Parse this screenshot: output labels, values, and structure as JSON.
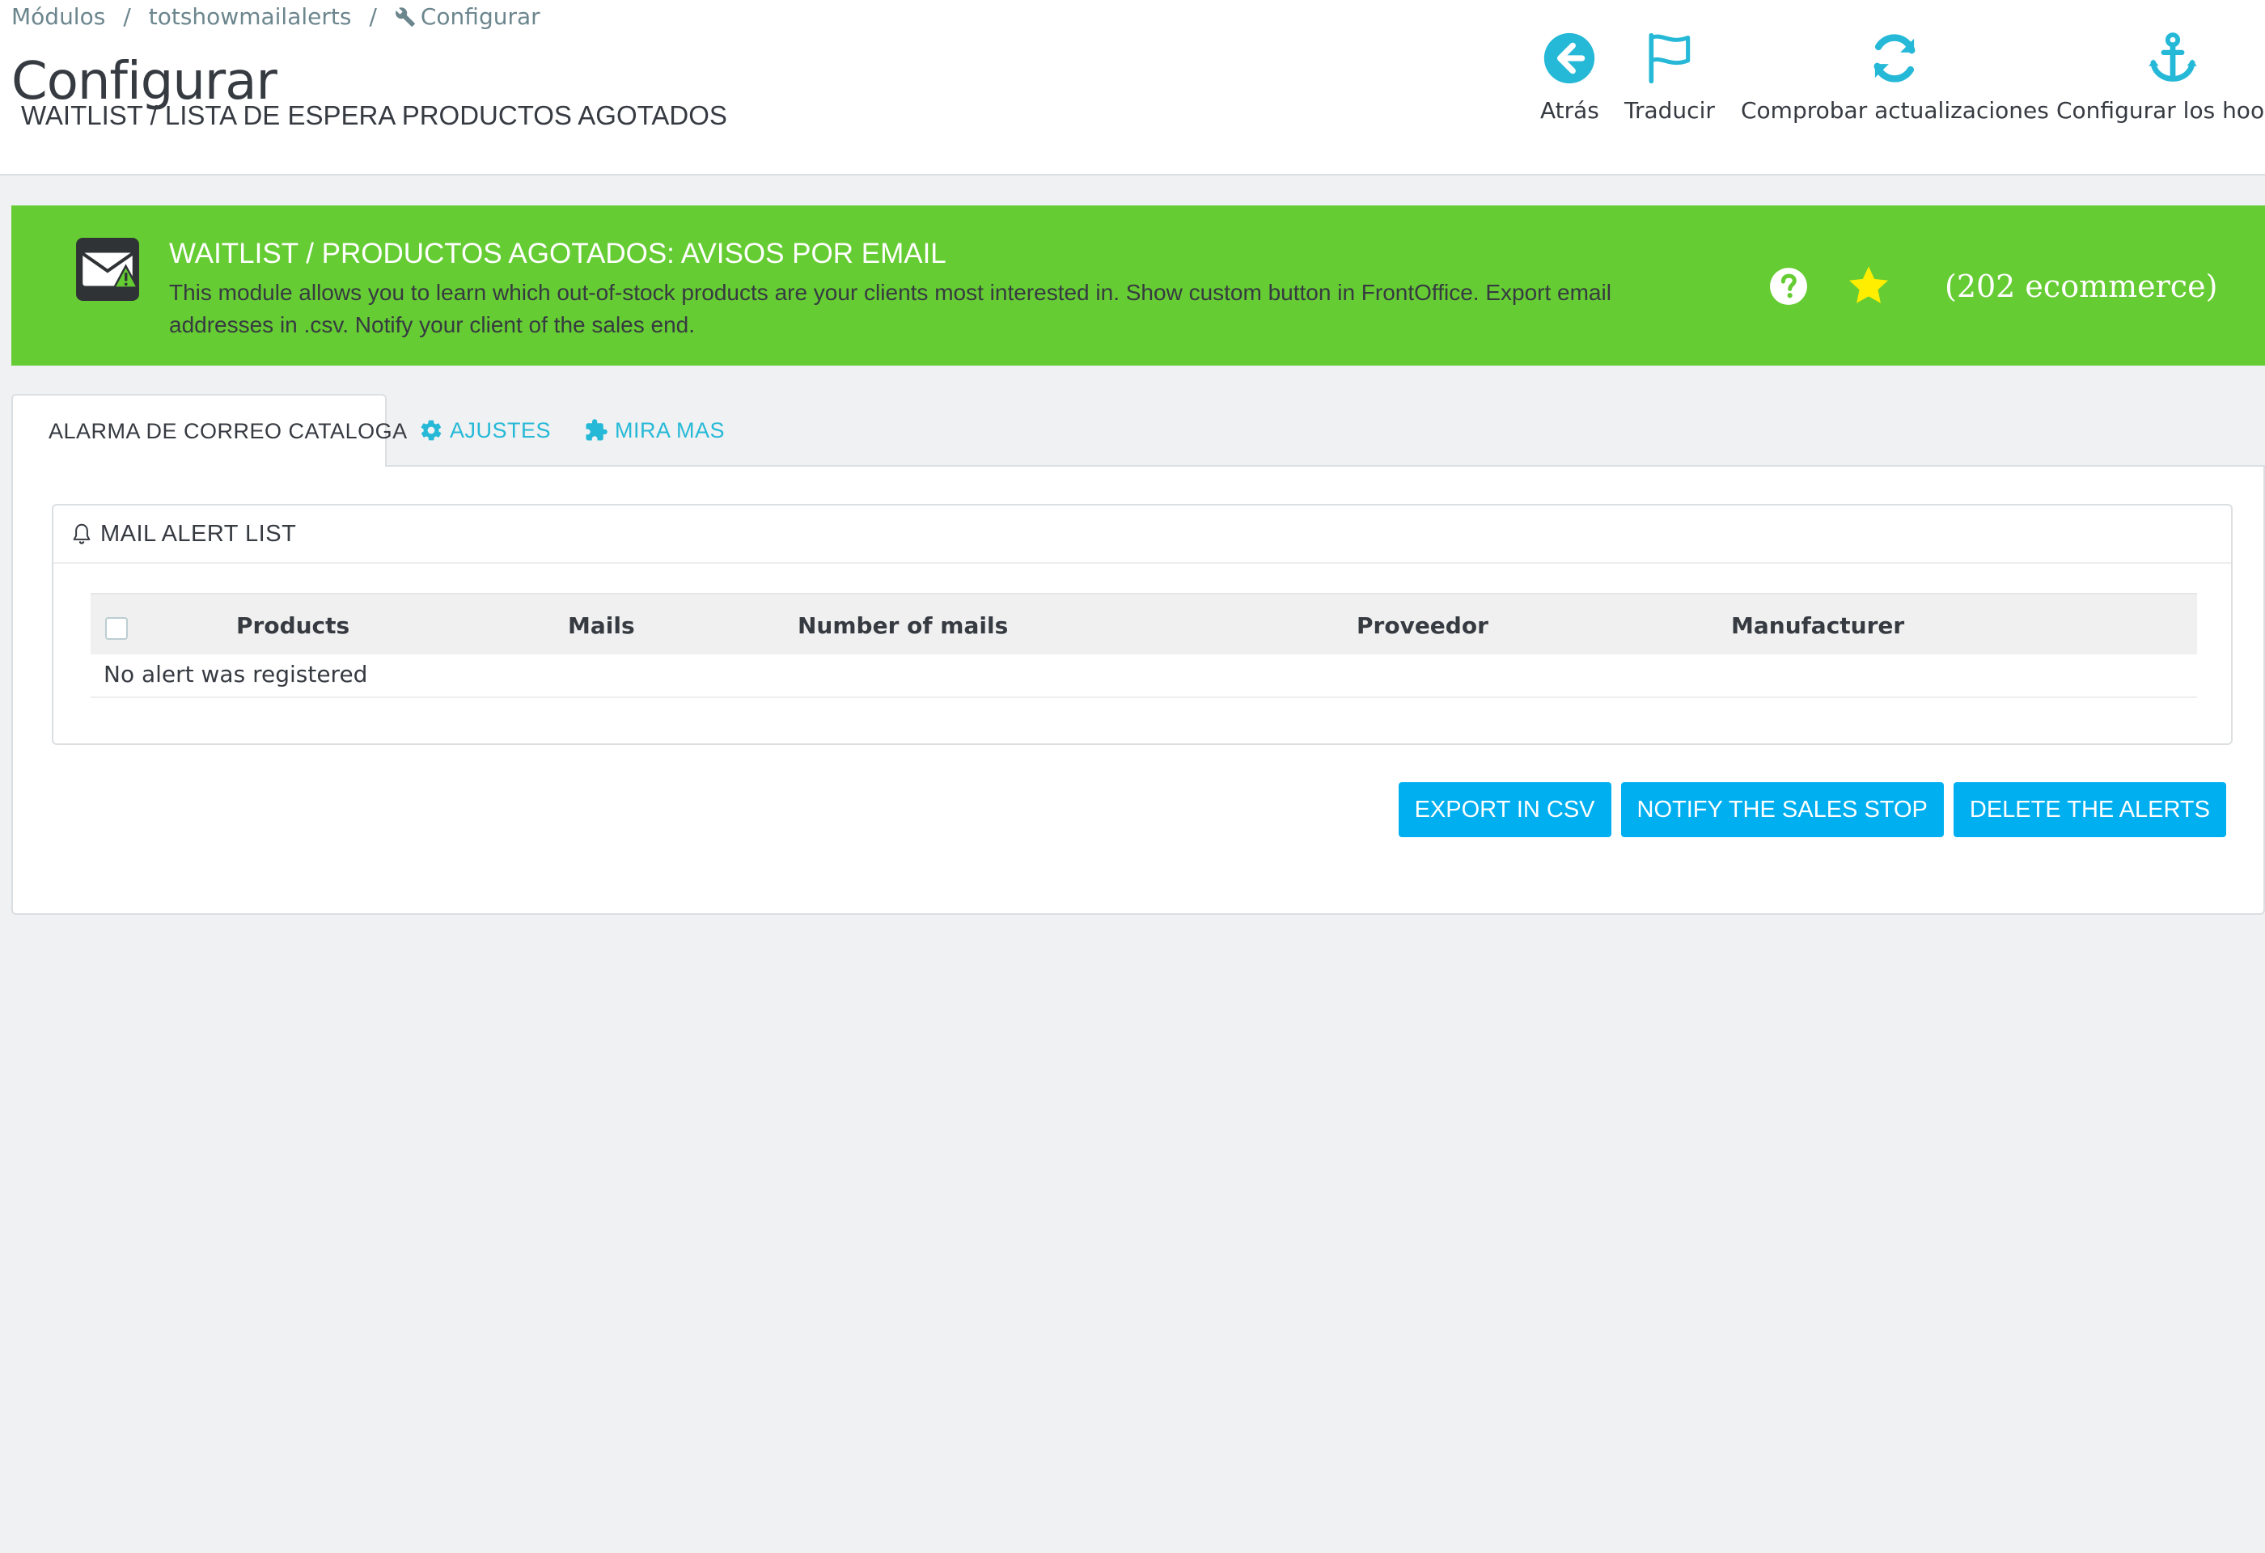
{
  "breadcrumb": {
    "items": [
      "Módulos",
      "totshowmailalerts",
      "Configurar"
    ],
    "separator": "/"
  },
  "header": {
    "title": "Configurar",
    "subtitle": "WAITLIST / LISTA DE ESPERA PRODUCTOS AGOTADOS"
  },
  "toolbar": {
    "back_label": "Atrás",
    "translate_label": "Traducir",
    "check_updates_label": "Comprobar actualizaciones",
    "hooks_label": "Configurar los hooks"
  },
  "banner": {
    "title": "WAITLIST / PRODUCTOS AGOTADOS: AVISOS POR EMAIL",
    "description": "This module allows you to learn which out-of-stock products are your clients most interested in. Show custom button in FrontOffice. Export email addresses in .csv. Notify your client of the sales end.",
    "count": "(202 ecommerce)",
    "icons": [
      "mail-alert-logo",
      "help-icon",
      "star-icon"
    ],
    "colors": {
      "background": "#66cc33",
      "star": "#ffee00"
    }
  },
  "tabs": [
    {
      "label": "ALARMA DE CORREO CATALOGA",
      "icon": "bell-icon",
      "active": true
    },
    {
      "label": "AJUSTES",
      "icon": "gear-icon",
      "active": false
    },
    {
      "label": "MIRA MAS",
      "icon": "puzzle-icon",
      "active": false
    }
  ],
  "panel": {
    "title": "MAIL ALERT LIST",
    "columns": [
      "Products",
      "Mails",
      "Number of mails",
      "Proveedor",
      "Manufacturer"
    ],
    "empty_message": "No alert was registered"
  },
  "actions": {
    "export_label": "EXPORT IN CSV",
    "notify_label": "NOTIFY THE SALES STOP",
    "delete_label": "DELETE THE ALERTS"
  },
  "colors": {
    "accent": "#25b9d7",
    "button": "#00aff0"
  }
}
